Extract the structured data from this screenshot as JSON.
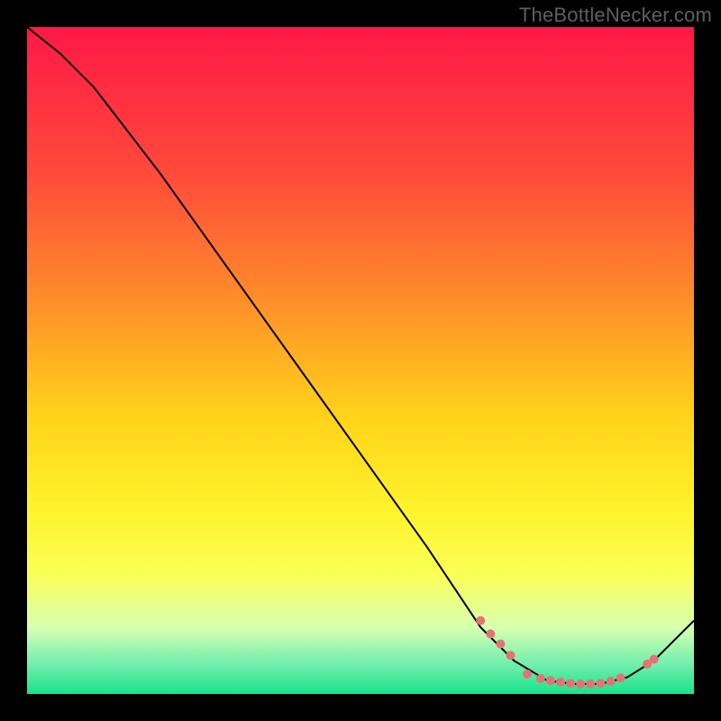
{
  "watermark": "TheBottleNecker.com",
  "chart_data": {
    "type": "line",
    "title": "",
    "xlabel": "",
    "ylabel": "",
    "xlim": [
      0,
      100
    ],
    "ylim": [
      0,
      100
    ],
    "grid": false,
    "legend": false,
    "gradient_stops": [
      {
        "offset": 0.0,
        "color": "#ff1846"
      },
      {
        "offset": 0.22,
        "color": "#ff4a3b"
      },
      {
        "offset": 0.4,
        "color": "#ff8a2a"
      },
      {
        "offset": 0.58,
        "color": "#ffd21a"
      },
      {
        "offset": 0.72,
        "color": "#fff22a"
      },
      {
        "offset": 0.82,
        "color": "#fbff55"
      },
      {
        "offset": 0.9,
        "color": "#d8ffb0"
      },
      {
        "offset": 0.95,
        "color": "#7cf0b0"
      },
      {
        "offset": 1.0,
        "color": "#19e38a"
      }
    ],
    "series": [
      {
        "name": "bottleneck-curve",
        "stroke": "#000000",
        "stroke_width": 2,
        "points": [
          {
            "x": 0,
            "y": 100
          },
          {
            "x": 5,
            "y": 96
          },
          {
            "x": 10,
            "y": 91
          },
          {
            "x": 20,
            "y": 78
          },
          {
            "x": 30,
            "y": 64
          },
          {
            "x": 40,
            "y": 50
          },
          {
            "x": 50,
            "y": 36
          },
          {
            "x": 60,
            "y": 22
          },
          {
            "x": 68,
            "y": 10
          },
          {
            "x": 73,
            "y": 5
          },
          {
            "x": 78,
            "y": 2
          },
          {
            "x": 82,
            "y": 1.5
          },
          {
            "x": 86,
            "y": 1.5
          },
          {
            "x": 90,
            "y": 2.5
          },
          {
            "x": 94,
            "y": 5
          },
          {
            "x": 100,
            "y": 11
          }
        ]
      }
    ],
    "markers": {
      "name": "highlight-dots",
      "color": "#e57373",
      "radius": 5,
      "points": [
        {
          "x": 68,
          "y": 11
        },
        {
          "x": 69.5,
          "y": 9
        },
        {
          "x": 71,
          "y": 7.5
        },
        {
          "x": 72.5,
          "y": 5.8
        },
        {
          "x": 75,
          "y": 3
        },
        {
          "x": 77,
          "y": 2.3
        },
        {
          "x": 78.5,
          "y": 2
        },
        {
          "x": 80,
          "y": 1.8
        },
        {
          "x": 81.5,
          "y": 1.6
        },
        {
          "x": 83,
          "y": 1.5
        },
        {
          "x": 84.5,
          "y": 1.5
        },
        {
          "x": 86,
          "y": 1.6
        },
        {
          "x": 87.5,
          "y": 1.9
        },
        {
          "x": 89,
          "y": 2.4
        },
        {
          "x": 93,
          "y": 4.5
        },
        {
          "x": 94,
          "y": 5.2
        }
      ]
    }
  }
}
